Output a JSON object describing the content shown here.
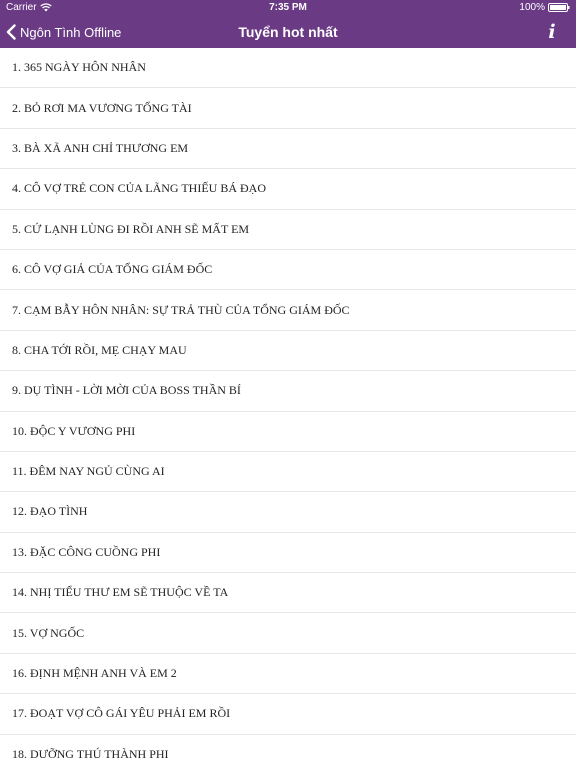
{
  "status_bar": {
    "carrier": "Carrier",
    "time": "7:35 PM",
    "battery": "100%"
  },
  "nav": {
    "back_label": "Ngôn Tình Offline",
    "title": "Tuyển hot nhất",
    "info_label": "i"
  },
  "theme": {
    "nav_color": "#6a3a85",
    "separator_color": "#e6e6e6"
  },
  "list": {
    "items": [
      "1. 365 NGÀY HÔN NHÂN",
      "2. BỎ RƠI MA VƯƠNG TỔNG TÀI",
      "3. BÀ XÃ ANH CHỈ THƯƠNG EM",
      "4. CÔ VỢ TRẺ CON CỦA LÃNG THIẾU BÁ ĐẠO",
      "5. CỨ LẠNH LÙNG ĐI RỒI ANH SẼ MẤT EM",
      "6. CÔ VỢ GIẢ CỦA TỔNG GIÁM ĐỐC",
      "7. CẠM BẪY HÔN NHÂN: SỰ TRẢ THÙ CỦA TỔNG GIÁM ĐỐC",
      "8. CHA TỚI RỒI, MẸ CHẠY MAU",
      "9. DỤ TÌNH - LỜI MỜI CỦA BOSS THẦN BÍ",
      "10. ĐỘC Y VƯƠNG PHI",
      "11. ĐÊM NAY NGỦ CÙNG AI",
      "12. ĐẠO TÌNH",
      "13. ĐẶC CÔNG CUỒNG PHI",
      "14. NHỊ TIỂU THƯ EM SẼ THUỘC VỀ TA",
      "15. VỢ NGỐC",
      "16. ĐỊNH MỆNH ANH VÀ EM 2",
      "17. ĐOẠT VỢ CÔ GÁI YÊU PHẢI EM RỒI",
      "18. DƯỠNG THÚ THÀNH PHI"
    ]
  }
}
